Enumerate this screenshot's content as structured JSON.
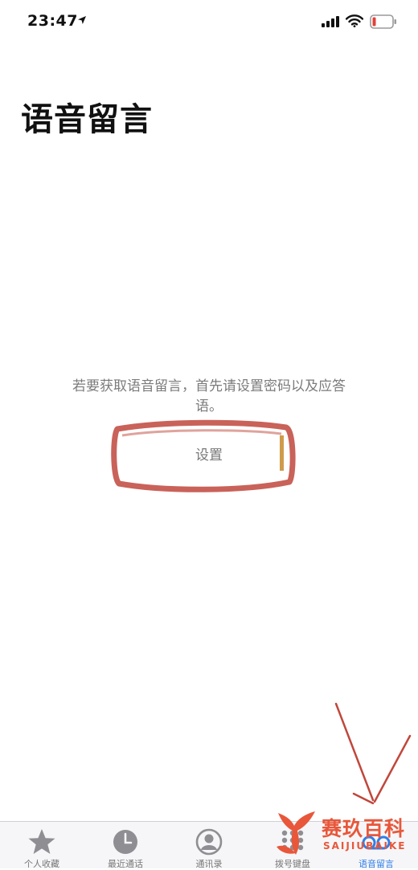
{
  "status_bar": {
    "time": "23:47",
    "icons": [
      "location-arrow-icon",
      "cellular-signal-icon",
      "wifi-icon",
      "battery-low-icon"
    ]
  },
  "page": {
    "title": "语音留言"
  },
  "empty_state": {
    "message": "若要获取语音留言，首先请设置密码以及应答语。",
    "button_label": "设置"
  },
  "tab_bar": {
    "tabs": [
      {
        "label": "个人收藏",
        "icon": "star-icon",
        "active": false
      },
      {
        "label": "最近通话",
        "icon": "clock-icon",
        "active": false
      },
      {
        "label": "通讯录",
        "icon": "contacts-icon",
        "active": false
      },
      {
        "label": "拨号键盘",
        "icon": "keypad-icon",
        "active": false
      },
      {
        "label": "语音留言",
        "icon": "voicemail-icon",
        "active": true
      }
    ]
  },
  "watermark": {
    "text": "赛玖百科",
    "subtext": "SAIJIUBAIKE"
  },
  "colors": {
    "accent": "#2f7ee8",
    "annotation": "#c0473c",
    "watermark": "#e8573a"
  }
}
